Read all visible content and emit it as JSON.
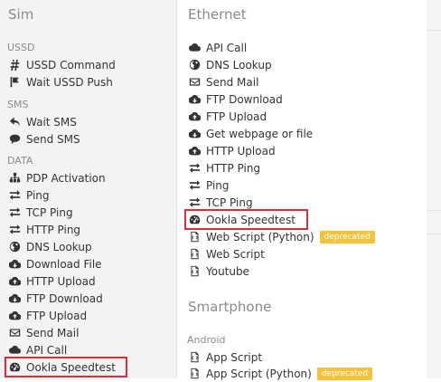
{
  "sim": {
    "title": "Sim",
    "groups": [
      {
        "title": "USSD",
        "items": [
          {
            "label": "USSD Command",
            "icon": "hash-icon"
          },
          {
            "label": "Wait USSD Push",
            "icon": "flag-icon"
          }
        ]
      },
      {
        "title": "SMS",
        "items": [
          {
            "label": "Wait SMS",
            "icon": "reply-icon"
          },
          {
            "label": "Send SMS",
            "icon": "comment-icon"
          }
        ]
      },
      {
        "title": "DATA",
        "items": [
          {
            "label": "PDP Activation",
            "icon": "sitemap-icon"
          },
          {
            "label": "Ping",
            "icon": "exchange-icon"
          },
          {
            "label": "TCP Ping",
            "icon": "exchange-icon"
          },
          {
            "label": "HTTP Ping",
            "icon": "exchange-icon"
          },
          {
            "label": "DNS Lookup",
            "icon": "globe-icon"
          },
          {
            "label": "Download File",
            "icon": "cloud-download-icon"
          },
          {
            "label": "HTTP Upload",
            "icon": "cloud-upload-icon"
          },
          {
            "label": "FTP Download",
            "icon": "cloud-download-icon"
          },
          {
            "label": "FTP Upload",
            "icon": "cloud-upload-icon"
          },
          {
            "label": "Send Mail",
            "icon": "envelope-icon"
          },
          {
            "label": "API Call",
            "icon": "cloud-icon"
          },
          {
            "label": "Ookla Speedtest",
            "icon": "dashboard-icon"
          }
        ]
      }
    ]
  },
  "ethernet": {
    "title": "Ethernet",
    "items": [
      {
        "label": "API Call",
        "icon": "cloud-icon"
      },
      {
        "label": "DNS Lookup",
        "icon": "globe-icon"
      },
      {
        "label": "Send Mail",
        "icon": "envelope-icon"
      },
      {
        "label": "FTP Download",
        "icon": "cloud-download-icon"
      },
      {
        "label": "FTP Upload",
        "icon": "cloud-upload-icon"
      },
      {
        "label": "Get webpage or file",
        "icon": "cloud-download-icon"
      },
      {
        "label": "HTTP Upload",
        "icon": "cloud-upload-icon"
      },
      {
        "label": "HTTP Ping",
        "icon": "exchange-icon"
      },
      {
        "label": "Ping",
        "icon": "exchange-icon"
      },
      {
        "label": "TCP Ping",
        "icon": "exchange-icon"
      },
      {
        "label": "Ookla Speedtest",
        "icon": "dashboard-icon"
      },
      {
        "label": "Web Script (Python)",
        "icon": "code-file-icon",
        "badge": "deprecated"
      },
      {
        "label": "Web Script",
        "icon": "code-file-icon"
      },
      {
        "label": "Youtube",
        "icon": "code-file-icon"
      }
    ]
  },
  "smartphone": {
    "title": "Smartphone",
    "groups": [
      {
        "title": "Android",
        "items": [
          {
            "label": "App Script",
            "icon": "code-file-icon"
          },
          {
            "label": "App Script (Python)",
            "icon": "code-file-icon",
            "badge": "deprecated"
          }
        ]
      }
    ]
  },
  "colors": {
    "highlight": "#d6303a",
    "badge": "#f4c33c",
    "sidebar_bg": "#f3f3f3"
  }
}
